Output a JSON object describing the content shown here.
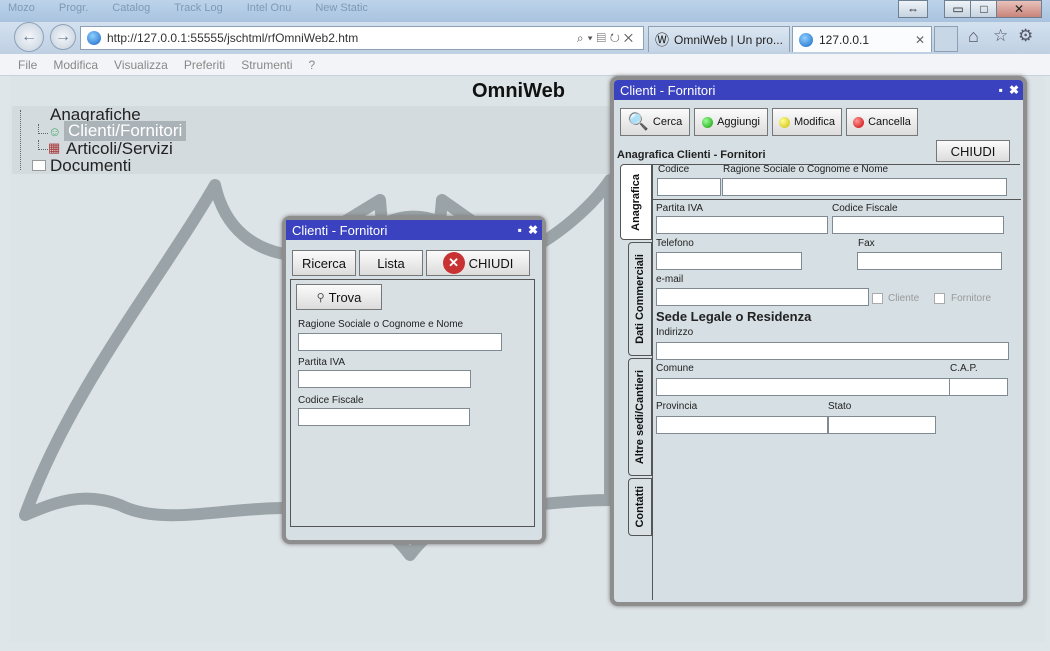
{
  "browser": {
    "favorites": [
      "Mozo",
      "Progr.",
      "Catalog",
      "Track Log",
      "Intel Onu",
      "New Static"
    ],
    "window_buttons": {
      "restore": "⇔",
      "minimize": "▭",
      "maximize": "□",
      "close": "✕"
    },
    "url": "http://127.0.0.1:55555/jschtml/rfOmniWeb2.htm",
    "tabs": [
      {
        "label": "OmniWeb | Un pro..."
      },
      {
        "label": "127.0.0.1",
        "close": "✕"
      }
    ],
    "menu": [
      "File",
      "Modifica",
      "Visualizza",
      "Preferiti",
      "Strumenti",
      "?"
    ]
  },
  "page": {
    "brand": "OmniWeb",
    "tree": {
      "root": "Anagrafiche",
      "items": [
        "Clienti/Fornitori",
        "Articoli/Servizi"
      ],
      "other": "Documenti"
    }
  },
  "search_dialog": {
    "title": "Clienti - Fornitori",
    "tabs": [
      "Ricerca",
      "Lista"
    ],
    "close_label": "CHIUDI",
    "find_label": "Trova",
    "fields": {
      "ragione": "Ragione Sociale o Cognome e Nome",
      "piva": "Partita IVA",
      "cf": "Codice Fiscale"
    }
  },
  "edit_dialog": {
    "title": "Clienti - Fornitori",
    "toolbar": {
      "cerca": "Cerca",
      "aggiungi": "Aggiungi",
      "modifica": "Modifica",
      "cancella": "Cancella"
    },
    "close_label": "CHIUDI",
    "heading": "Anagrafica Clienti - Fornitori",
    "side_tabs": [
      "Anagrafica",
      "Dati Commerciali",
      "Altre sedi/Cantieri",
      "Contatti"
    ],
    "labels": {
      "codice": "Codice",
      "ragione": "Ragione Sociale o Cognome e Nome",
      "piva": "Partita IVA",
      "cf": "Codice Fiscale",
      "telefono": "Telefono",
      "fax": "Fax",
      "email": "e-mail",
      "cliente": "Cliente",
      "fornitore": "Fornitore",
      "sede": "Sede Legale o Residenza",
      "indirizzo": "Indirizzo",
      "comune": "Comune",
      "cap": "C.A.P.",
      "provincia": "Provincia",
      "stato": "Stato"
    }
  },
  "colors": {
    "title_bar": "#3a42c0",
    "dialog_bg": "#d6dfe3",
    "page_bg": "#dde4e7"
  }
}
